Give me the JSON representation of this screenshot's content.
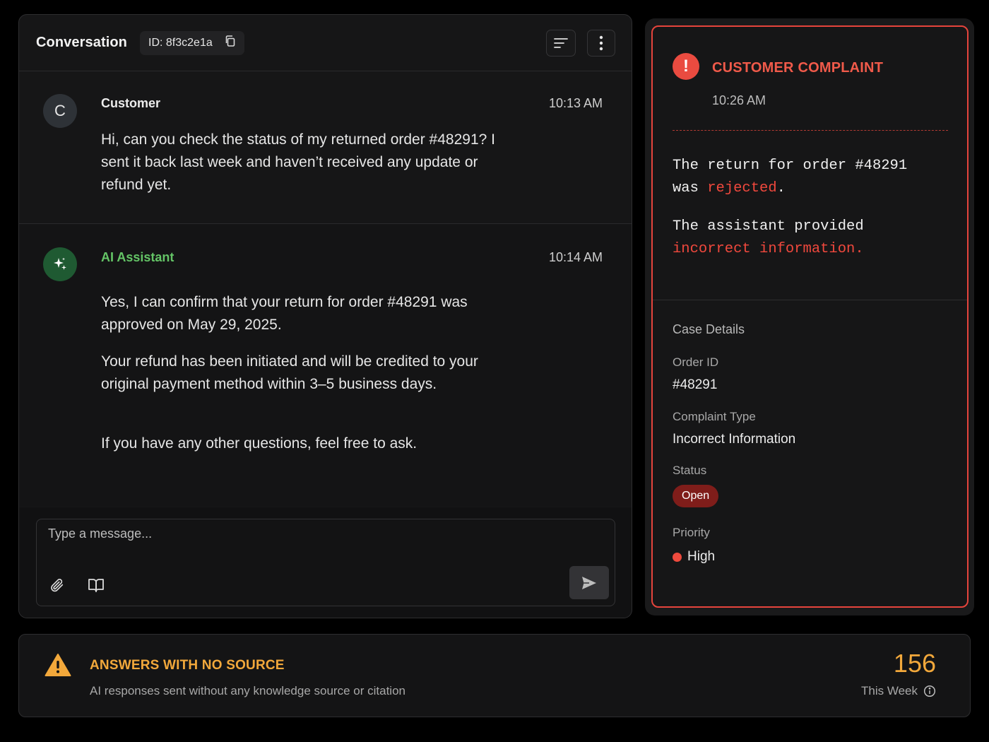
{
  "conversation": {
    "title": "Conversation",
    "id_label": "ID: 8f3c2e1a",
    "messages": [
      {
        "avatar": "C",
        "sender": "Customer",
        "time": "10:13 AM",
        "paragraphs": [
          "Hi, can you check the status of my returned order #48291? I sent it back last week and haven’t received any update or refund yet."
        ]
      },
      {
        "avatar_icon": "sparkle-icon",
        "sender": "AI Assistant",
        "time": "10:14 AM",
        "paragraphs": [
          "Yes, I can confirm that your return for order #48291 was approved on May 29, 2025.",
          "Your refund has been initiated and will be credited to your original payment method within 3–5 business days.",
          "If you have any other questions, feel free to ask."
        ]
      }
    ],
    "composer": {
      "placeholder": "Type a message..."
    }
  },
  "complaint": {
    "title": "CUSTOMER COMPLAINT",
    "time": "10:26 AM",
    "summary1": {
      "pre": "The return for order #48291",
      "line2_pre": "was ",
      "highlight": "rejected",
      "post": "."
    },
    "summary2": {
      "pre": "The assistant provided",
      "highlight": "incorrect information",
      "post": "."
    },
    "case_details": {
      "heading": "Case Details",
      "order_id_label": "Order ID",
      "order_id": "#48291",
      "type_label": "Complaint Type",
      "type": "Incorrect Information",
      "status_label": "Status",
      "status": "Open",
      "priority_label": "Priority",
      "priority": "High"
    }
  },
  "stat": {
    "title": "ANSWERS WITH NO SOURCE",
    "description": "AI responses sent without any knowledge source or citation",
    "value": "156",
    "period": "This Week"
  },
  "colors": {
    "accent_red": "#e5443c",
    "ai_green": "#64c466",
    "warning_amber": "#f2a83b"
  }
}
